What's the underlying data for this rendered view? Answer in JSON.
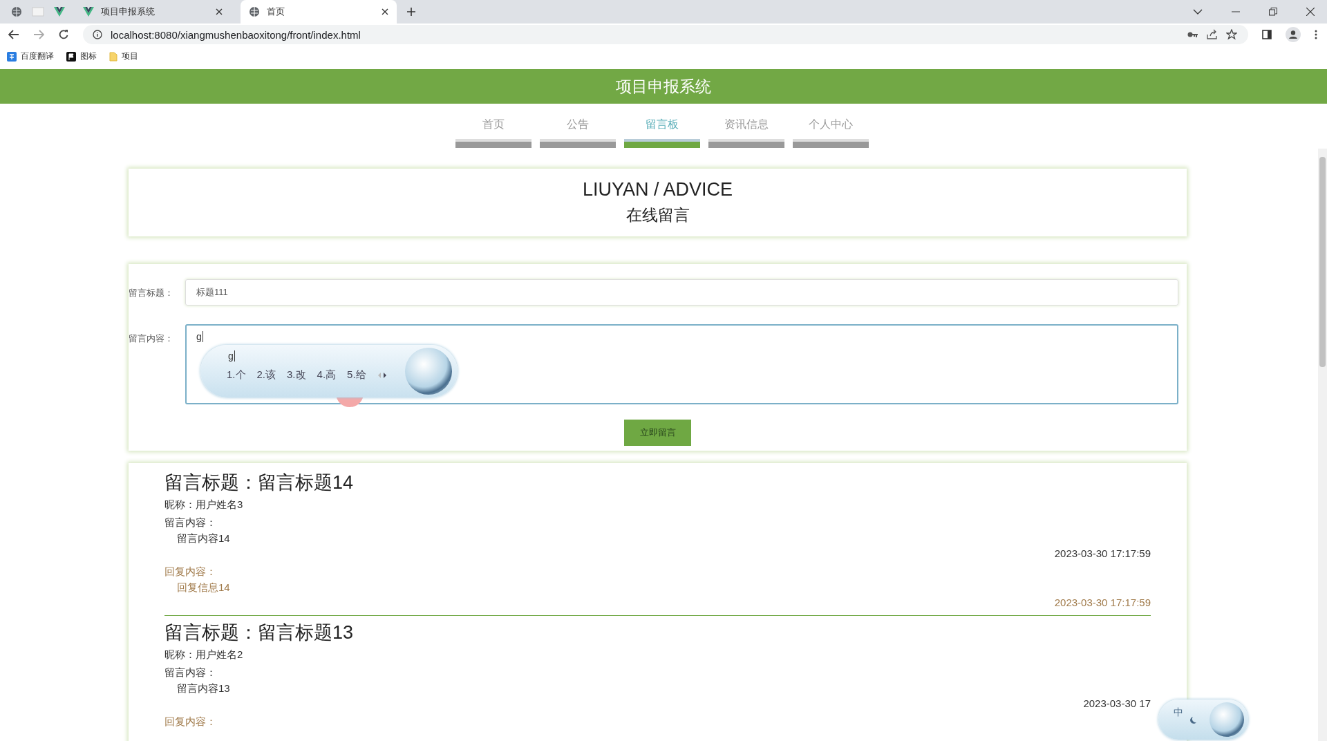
{
  "browser": {
    "tabs": [
      {
        "title": "项目申报系统",
        "selected": false
      },
      {
        "title": "首页",
        "selected": true
      }
    ],
    "url": "localhost:8080/xiangmushenbaoxitong/front/index.html",
    "bookmarks": [
      {
        "label": "百度翻译",
        "kind": "translate"
      },
      {
        "label": "图标",
        "kind": "flag"
      },
      {
        "label": "项目",
        "kind": "folder"
      }
    ]
  },
  "site": {
    "title": "项目申报系统"
  },
  "nav": [
    {
      "label": "首页",
      "selected": false
    },
    {
      "label": "公告",
      "selected": false
    },
    {
      "label": "留言板",
      "selected": true
    },
    {
      "label": "资讯信息",
      "selected": false
    },
    {
      "label": "个人中心",
      "selected": false
    }
  ],
  "banner": {
    "title": "LIUYAN / ADVICE",
    "subtitle": "在线留言"
  },
  "form": {
    "fields": [
      {
        "label": "留言标题：",
        "value": "标题111",
        "kind": "input"
      },
      {
        "label": "留言内容：",
        "value": "g",
        "kind": "textarea"
      }
    ],
    "submit": "立即留言"
  },
  "ime": {
    "composition": "g",
    "candidates": [
      "1.个",
      "2.该",
      "3.改",
      "4.高",
      "5.给"
    ]
  },
  "messages": [
    {
      "title": "留言标题：留言标题14",
      "nickname": "昵称：用户姓名3",
      "content_label": "留言内容：",
      "content": "留言内容14",
      "time": "2023-03-30 17:17:59",
      "reply_label": "回复内容：",
      "reply": "回复信息14",
      "reply_time": "2023-03-30 17:17:59"
    },
    {
      "title": "留言标题：留言标题13",
      "nickname": "昵称：用户姓名2",
      "content_label": "留言内容：",
      "content": "留言内容13",
      "time": "2023-03-30 17",
      "reply_label": "回复内容："
    }
  ],
  "ime_status": {
    "mode": "中"
  }
}
